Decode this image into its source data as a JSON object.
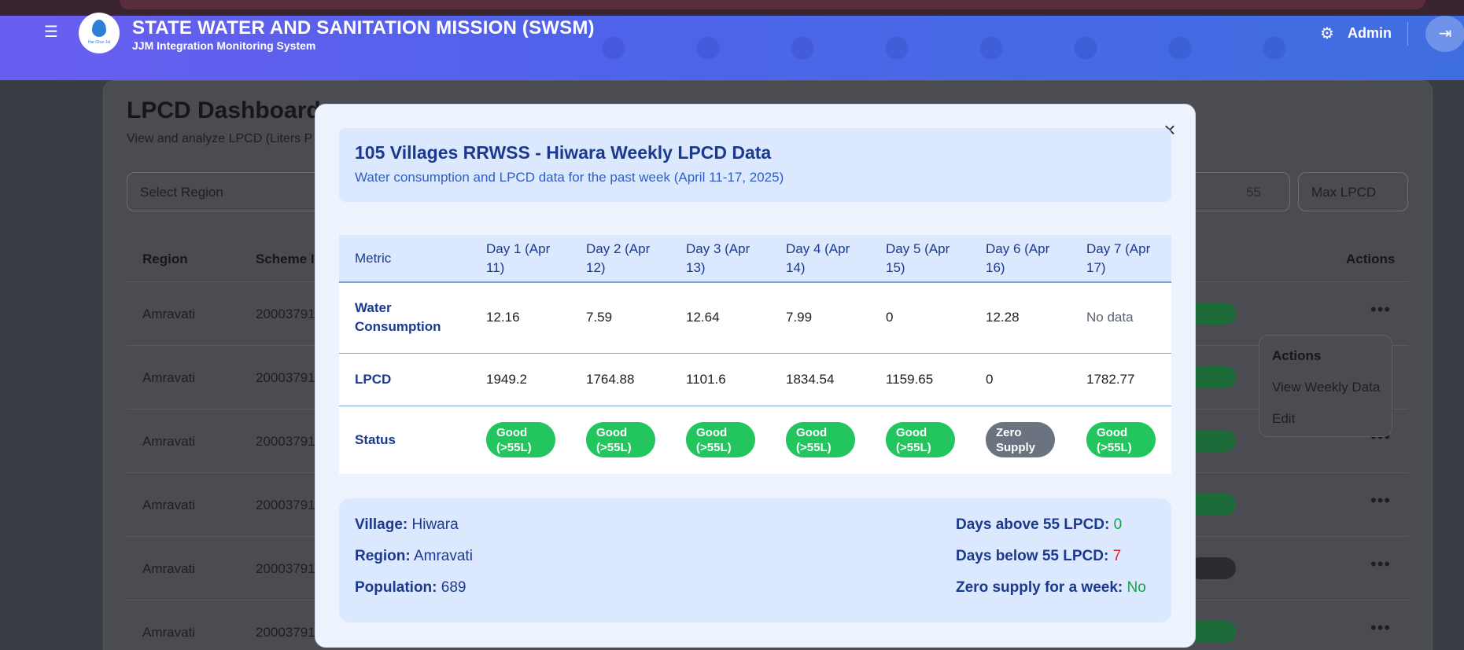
{
  "header": {
    "app_title": "STATE WATER AND SANITATION MISSION (SWSM)",
    "app_subtitle": "JJM Integration Monitoring System",
    "logo_text": "Har Ghar Jal",
    "user": "Admin"
  },
  "background": {
    "page_title": "LPCD Dashboard",
    "page_desc": "View and analyze LPCD (Liters P",
    "region_select": "Select Region",
    "min_lpcd_partial": "55",
    "max_lpcd_placeholder": "Max LPCD",
    "columns": {
      "region": "Region",
      "scheme": "Scheme II",
      "actions": "Actions"
    },
    "rows": [
      {
        "region": "Amravati",
        "scheme": "20003791"
      },
      {
        "region": "Amravati",
        "scheme": "20003791"
      },
      {
        "region": "Amravati",
        "scheme": "20003791"
      },
      {
        "region": "Amravati",
        "scheme": "20003791"
      },
      {
        "region": "Amravati",
        "scheme": "20003791"
      },
      {
        "region": "Amravati",
        "scheme": "20003791"
      }
    ],
    "actions_menu": {
      "heading": "Actions",
      "items": [
        "View Weekly Data",
        "Edit"
      ]
    }
  },
  "modal": {
    "title": "105 Villages RRWSS - Hiwara Weekly LPCD Data",
    "subtitle": "Water consumption and LPCD data for the past week (April 11-17, 2025)",
    "columns": [
      "Metric",
      "Day 1 (Apr 11)",
      "Day 2 (Apr 12)",
      "Day 3 (Apr 13)",
      "Day 4 (Apr 14)",
      "Day 5 (Apr 15)",
      "Day 6 (Apr 16)",
      "Day 7 (Apr 17)"
    ],
    "water_consumption": {
      "label": "Water Consumption",
      "values": [
        "12.16",
        "7.59",
        "12.64",
        "7.99",
        "0",
        "12.28",
        "No data"
      ]
    },
    "lpcd": {
      "label": "LPCD",
      "values": [
        "1949.2",
        "1764.88",
        "1101.6",
        "1834.54",
        "1159.65",
        "0",
        "1782.77"
      ]
    },
    "status": {
      "label": "Status",
      "values": [
        "Good (>55L)",
        "Good (>55L)",
        "Good (>55L)",
        "Good (>55L)",
        "Good (>55L)",
        "Zero Supply",
        "Good (>55L)"
      ]
    },
    "summary": {
      "village_label": "Village:",
      "village": "Hiwara",
      "region_label": "Region:",
      "region": "Amravati",
      "population_label": "Population:",
      "population": "689",
      "above_label": "Days above 55 LPCD:",
      "above": "0",
      "below_label": "Days below 55 LPCD:",
      "below": "7",
      "zero_label": "Zero supply for a week:",
      "zero": "No"
    }
  }
}
